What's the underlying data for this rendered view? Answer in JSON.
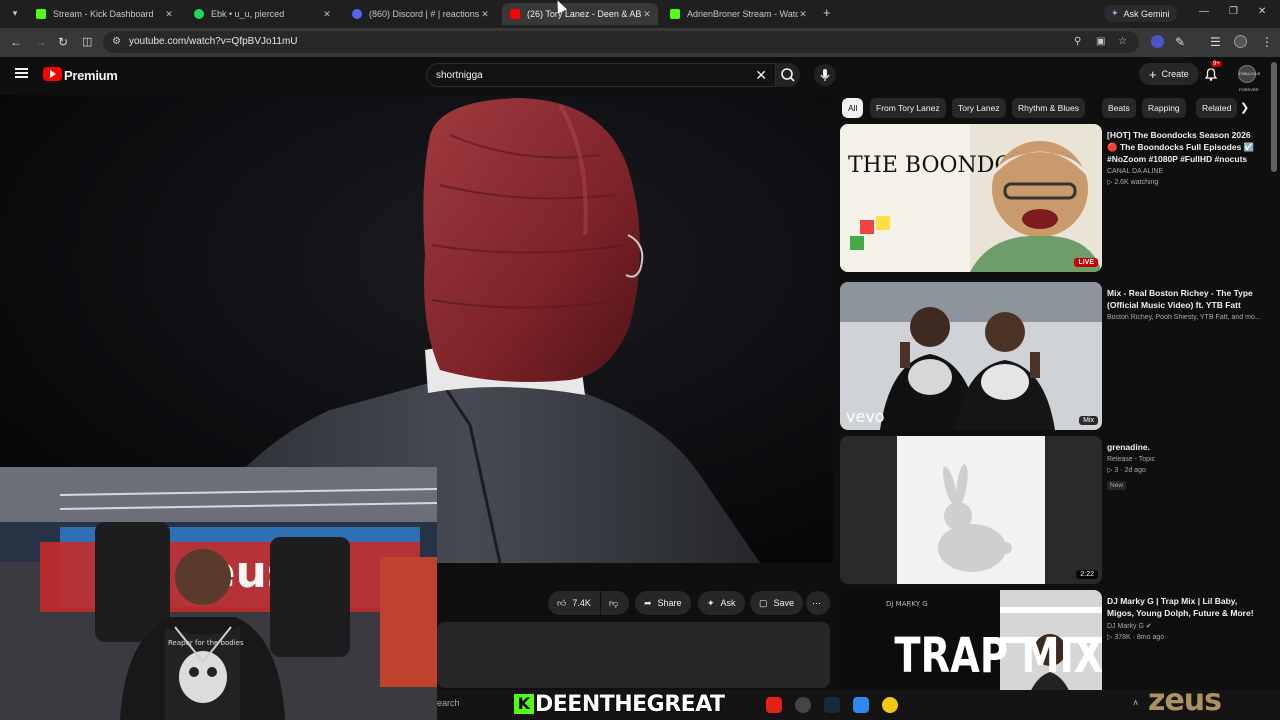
{
  "browser": {
    "tabs": [
      {
        "title": "Stream - Kick Dashboard",
        "favicon_color": "#53fc18",
        "active": false
      },
      {
        "title": "Ebk • u_u, pierced",
        "favicon_color": "#1ed760",
        "active": false
      },
      {
        "title": "(860) Discord | # | reactions",
        "favicon_color": "#5865f2",
        "active": false
      },
      {
        "title": "(26) Tory Lanez - Deen & AB //",
        "favicon_color": "#ff0000",
        "active": true
      },
      {
        "title": "AdrienBroner Stream - Watch L",
        "favicon_color": "#53fc18",
        "active": false
      }
    ],
    "ask_gemini": "Ask Gemini",
    "url": "youtube.com/watch?v=QfpBVJo11mU"
  },
  "youtube": {
    "brand": "Premium",
    "search_query": "shortnigga",
    "create_label": "Create",
    "notif_count": "9+",
    "avatar_text": "FABULOUS FOREVER"
  },
  "video_actions": {
    "like_count": "7.4K",
    "share": "Share",
    "ask": "Ask",
    "save": "Save"
  },
  "chips": [
    "All",
    "From Tory Lanez",
    "Tory Lanez",
    "Rhythm & Blues",
    "Beats",
    "Rapping",
    "Related"
  ],
  "recommendations": [
    {
      "title": "[HOT] The Boondocks Season 2026 🔴 The Boondocks Full Episodes ☑️ #NoZoom #1080P #FullHD #nocuts",
      "channel": "CANAL DA ALINE",
      "meta": "▷ 2.6K watching",
      "badge": "LIVE",
      "thumb_text": "THE BOONDOCKS"
    },
    {
      "title": "Mix - Real Boston Richey - The Type (Official Music Video) ft. YTB Fatt",
      "channel": "Boston Richey, Pooh Shiesty, YTB Fatt, and mo...",
      "meta": "",
      "badge": "Mix",
      "thumb_text": "vevo"
    },
    {
      "title": "grenadine.",
      "channel": "Release - Topic",
      "meta": "▷ 3 · 2d ago",
      "tag": "New",
      "badge": "2:22",
      "thumb_text": ""
    },
    {
      "title": "DJ Marky G | Trap Mix | Lil Baby, Migos, Young Dolph, Future & More!",
      "channel": "DJ Marky G",
      "meta": "▷ 378K · 8mo ago",
      "badge": "",
      "thumb_text": "TRAP MIX",
      "thumb_subtext": "DJ MARKY G"
    }
  ],
  "overlay": {
    "streamer_k": "K",
    "streamer_name": "DEENTHEGREAT",
    "brand": "zeus",
    "webcam_banner": "zeus",
    "shirt_text": "Reaper for the bodies",
    "taskbar_search": "earch"
  },
  "colors": {
    "kick_green": "#53fc18",
    "youtube_red": "#ff0000",
    "mask_red": "#8e2a30",
    "suit_gray": "#3b3e45"
  }
}
